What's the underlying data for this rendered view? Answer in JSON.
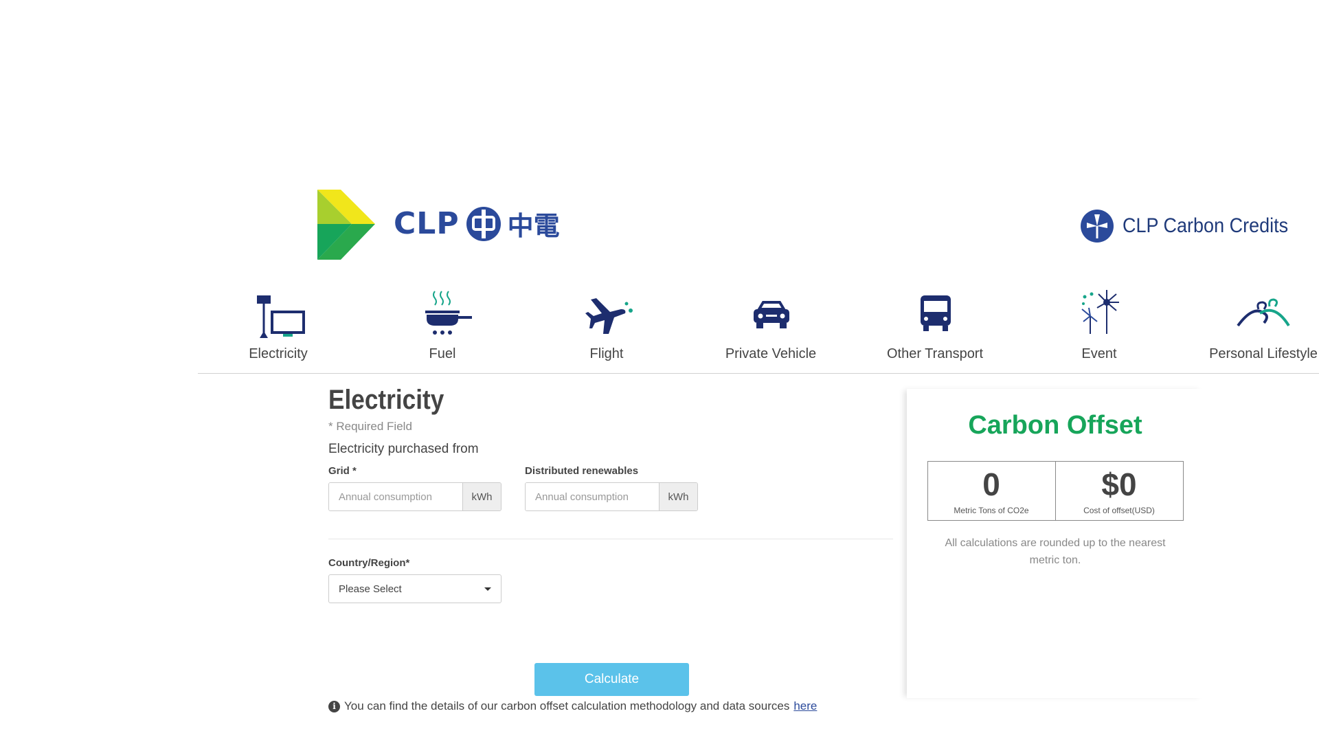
{
  "header": {
    "logo_text": "CLP",
    "logo_cjk": "中電",
    "brand_title": "CLP Carbon Credits"
  },
  "categories": [
    {
      "label": "Electricity",
      "icon": "electricity-icon"
    },
    {
      "label": "Fuel",
      "icon": "fuel-icon"
    },
    {
      "label": "Flight",
      "icon": "flight-icon"
    },
    {
      "label": "Private Vehicle",
      "icon": "car-icon"
    },
    {
      "label": "Other Transport",
      "icon": "bus-icon"
    },
    {
      "label": "Event",
      "icon": "fireworks-icon"
    },
    {
      "label": "Personal Lifestyle",
      "icon": "hanger-icon"
    }
  ],
  "form": {
    "title": "Electricity",
    "required_note": "* Required Field",
    "purchased_label": "Electricity purchased from",
    "grid_label": "Grid *",
    "grid_placeholder": "Annual consumption",
    "grid_unit": "kWh",
    "renewables_label": "Distributed renewables",
    "renewables_placeholder": "Annual consumption",
    "renewables_unit": "kWh",
    "country_label": "Country/Region*",
    "country_value": "Please Select",
    "calculate_label": "Calculate",
    "info_text": "You can find the details of our carbon offset calculation methodology and data sources",
    "info_link": "here"
  },
  "offset": {
    "title": "Carbon Offset",
    "tons_value": "0",
    "tons_caption": "Metric Tons of CO2e",
    "cost_value": "$0",
    "cost_caption": "Cost of offset(USD)",
    "note": "All calculations are rounded up to the nearest metric ton."
  },
  "colors": {
    "brand_blue": "#2b4a9b",
    "green": "#17a55a",
    "button": "#5bc2ea",
    "icon_navy": "#1d2d6e",
    "icon_teal": "#17a58a"
  }
}
